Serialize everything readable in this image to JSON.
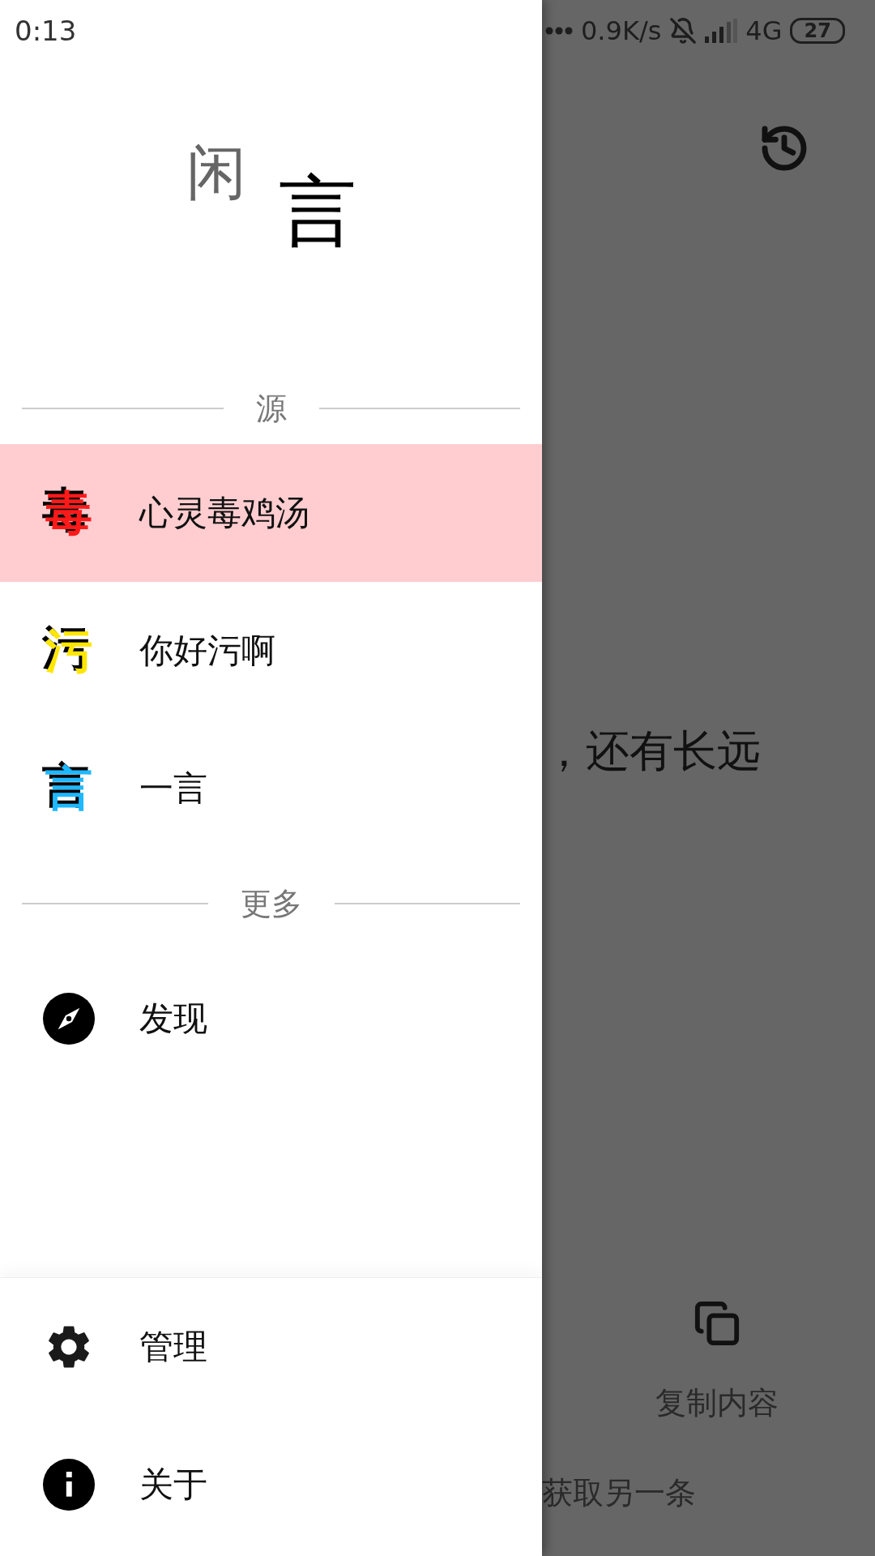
{
  "status_bar": {
    "time": "0:13",
    "speed": "0.9K/s",
    "network": "4G",
    "battery": "27"
  },
  "drawer": {
    "logo": {
      "first": "闲",
      "second": "言"
    },
    "sections": [
      {
        "title": "源",
        "items": [
          {
            "kind": "glyph",
            "glyph": "毒",
            "color": "#ff1a1a",
            "label": "心灵毒鸡汤",
            "selected": true
          },
          {
            "kind": "glyph",
            "glyph": "污",
            "color": "#ffe600",
            "label": "你好污啊",
            "selected": false
          },
          {
            "kind": "glyph",
            "glyph": "言",
            "color": "#1eb8ff",
            "label": "一言",
            "selected": false
          }
        ]
      },
      {
        "title": "更多",
        "items": [
          {
            "kind": "compass",
            "label": "发现",
            "selected": false
          }
        ]
      }
    ],
    "footer": [
      {
        "kind": "gear",
        "label": "管理",
        "selected": false
      },
      {
        "kind": "info",
        "label": "关于",
        "selected": false
      }
    ]
  },
  "main": {
    "quote": "，还有长远",
    "copy_label": "复制内容",
    "next_label": "获取另一条"
  }
}
